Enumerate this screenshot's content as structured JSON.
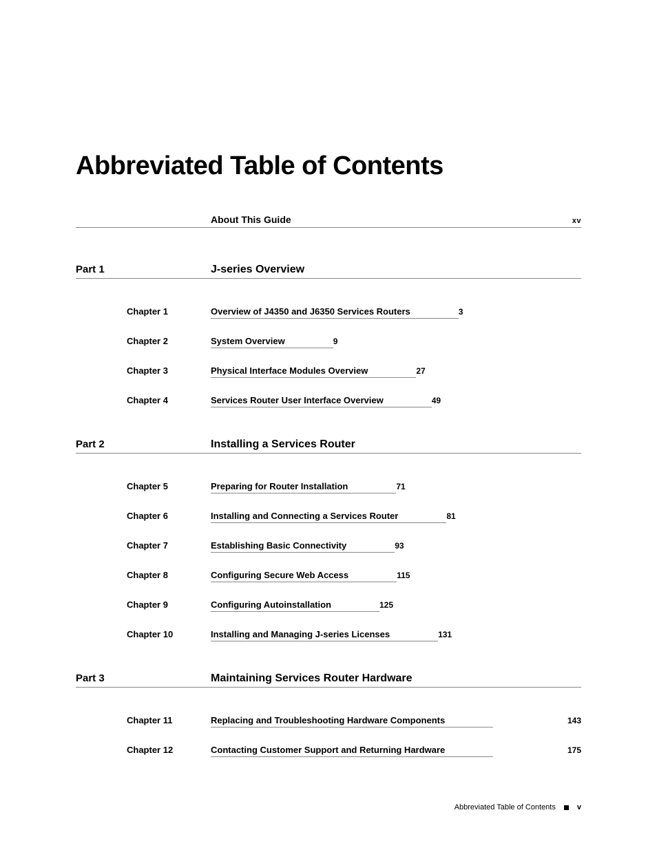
{
  "title": "Abbreviated Table of Contents",
  "top_entry": {
    "label": "About This Guide",
    "page": "xv"
  },
  "parts": [
    {
      "part_label": "Part 1",
      "part_title": "J-series Overview",
      "chapters": [
        {
          "ch_label": "Chapter 1",
          "ch_title": "Overview of J4350 and J6350 Services Routers",
          "ch_page": "3"
        },
        {
          "ch_label": "Chapter 2",
          "ch_title": "System Overview",
          "ch_page": "9"
        },
        {
          "ch_label": "Chapter 3",
          "ch_title": "Physical Interface Modules Overview",
          "ch_page": "27"
        },
        {
          "ch_label": "Chapter 4",
          "ch_title": "Services Router User Interface Overview",
          "ch_page": "49"
        }
      ]
    },
    {
      "part_label": "Part 2",
      "part_title": "Installing a Services Router",
      "chapters": [
        {
          "ch_label": "Chapter 5",
          "ch_title": "Preparing for Router Installation",
          "ch_page": "71"
        },
        {
          "ch_label": "Chapter 6",
          "ch_title": "Installing and Connecting a Services Router",
          "ch_page": "81"
        },
        {
          "ch_label": "Chapter 7",
          "ch_title": "Establishing Basic Connectivity",
          "ch_page": "93"
        },
        {
          "ch_label": "Chapter 8",
          "ch_title": "Configuring Secure Web Access",
          "ch_page": "115"
        },
        {
          "ch_label": "Chapter 9",
          "ch_title": "Configuring Autoinstallation",
          "ch_page": "125"
        },
        {
          "ch_label": "Chapter 10",
          "ch_title": "Installing and Managing J-series Licenses",
          "ch_page": "131"
        }
      ]
    },
    {
      "part_label": "Part 3",
      "part_title": "Maintaining Services Router Hardware",
      "chapters": [
        {
          "ch_label": "Chapter 11",
          "ch_title": "Replacing and Troubleshooting Hardware Components",
          "ch_page": "143",
          "wide": true
        },
        {
          "ch_label": "Chapter 12",
          "ch_title": "Contacting Customer Support and Returning Hardware",
          "ch_page": "175",
          "wide": true
        }
      ]
    }
  ],
  "footer": {
    "text": "Abbreviated Table of Contents",
    "page": "v"
  }
}
